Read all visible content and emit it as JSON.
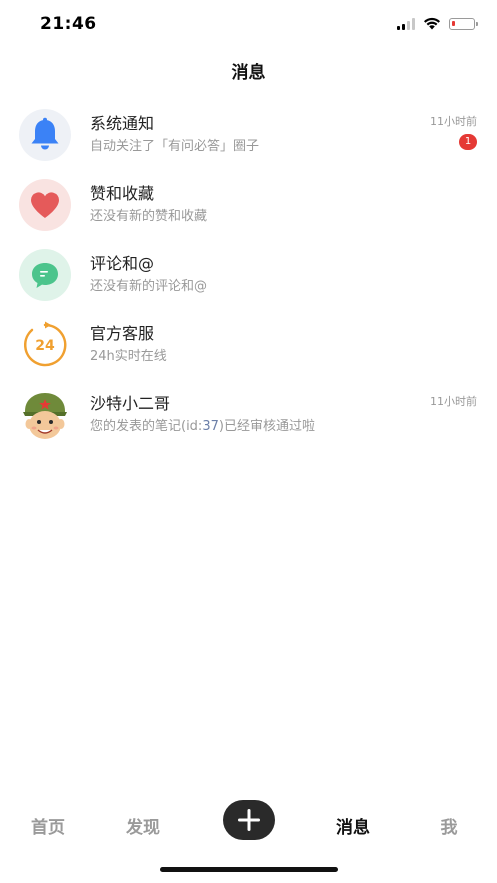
{
  "status_bar": {
    "time": "21:46",
    "battery_color": "#e53935",
    "battery_level": 0.15
  },
  "header": {
    "title": "消息"
  },
  "messages": [
    {
      "title": "系统通知",
      "subtitle": "自动关注了「有问必答」圈子",
      "time": "11小时前",
      "badge": "1",
      "icon": "bell-icon",
      "icon_color": "#3b82f6"
    },
    {
      "title": "赞和收藏",
      "subtitle": "还没有新的赞和收藏",
      "icon": "heart-icon",
      "icon_color": "#e55a5a"
    },
    {
      "title": "评论和@",
      "subtitle": "还没有新的评论和@",
      "icon": "comment-icon",
      "icon_color": "#4cc48c"
    },
    {
      "title": "官方客服",
      "subtitle": "24h实时在线",
      "icon": "clock-24-icon",
      "icon_text": "24",
      "icon_color": "#f0a030"
    },
    {
      "title": "沙特小二哥",
      "subtitle_prefix": "您的发表的笔记(id:",
      "subtitle_highlight": "37",
      "subtitle_suffix": ")已经审核通过啦",
      "time": "11小时前",
      "icon": "soldier-avatar-icon"
    }
  ],
  "tab_bar": {
    "tabs": [
      "首页",
      "发现",
      "消息",
      "我"
    ],
    "active": "消息",
    "add_icon": "plus-icon"
  }
}
